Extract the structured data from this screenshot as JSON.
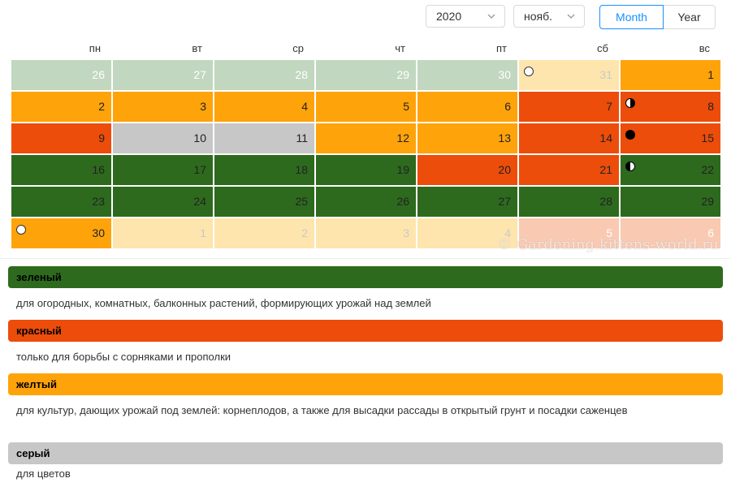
{
  "controls": {
    "year_value": "2020",
    "month_value": "нояб.",
    "mode_month": "Month",
    "mode_year": "Year",
    "accent": "#1890ff"
  },
  "weekdays": [
    "пн",
    "вт",
    "ср",
    "чт",
    "пт",
    "сб",
    "вс"
  ],
  "palette": {
    "prev": "#c1d7bf",
    "green": "#2d6a1e",
    "red": "#ec4d0a",
    "orange": "#ffa30a",
    "gray": "#c7c7c7",
    "paleyellow": "#fde5ad",
    "palepeach": "#f9c9b2"
  },
  "calendar": {
    "rows": [
      [
        [
          "26",
          "prev",
          ""
        ],
        [
          "27",
          "prev",
          ""
        ],
        [
          "28",
          "prev",
          ""
        ],
        [
          "29",
          "prev",
          ""
        ],
        [
          "30",
          "prev",
          ""
        ],
        [
          "31",
          "paleyellow",
          "new"
        ],
        [
          "1",
          "orange",
          ""
        ]
      ],
      [
        [
          "2",
          "orange",
          ""
        ],
        [
          "3",
          "orange",
          ""
        ],
        [
          "4",
          "orange",
          ""
        ],
        [
          "5",
          "orange",
          ""
        ],
        [
          "6",
          "orange",
          ""
        ],
        [
          "7",
          "red",
          ""
        ],
        [
          "8",
          "red",
          "first"
        ]
      ],
      [
        [
          "9",
          "red",
          ""
        ],
        [
          "10",
          "gray",
          ""
        ],
        [
          "11",
          "gray",
          ""
        ],
        [
          "12",
          "orange",
          ""
        ],
        [
          "13",
          "orange",
          ""
        ],
        [
          "14",
          "red",
          ""
        ],
        [
          "15",
          "red",
          "full"
        ]
      ],
      [
        [
          "16",
          "green",
          ""
        ],
        [
          "17",
          "green",
          ""
        ],
        [
          "18",
          "green",
          ""
        ],
        [
          "19",
          "green",
          ""
        ],
        [
          "20",
          "red",
          ""
        ],
        [
          "21",
          "red",
          ""
        ],
        [
          "22",
          "green",
          "last"
        ]
      ],
      [
        [
          "23",
          "green",
          ""
        ],
        [
          "24",
          "green",
          ""
        ],
        [
          "25",
          "green",
          ""
        ],
        [
          "26",
          "green",
          ""
        ],
        [
          "27",
          "green",
          ""
        ],
        [
          "28",
          "green",
          ""
        ],
        [
          "29",
          "green",
          ""
        ]
      ],
      [
        [
          "30",
          "orange",
          "new"
        ],
        [
          "1",
          "paleyellow",
          ""
        ],
        [
          "2",
          "paleyellow",
          ""
        ],
        [
          "3",
          "paleyellow",
          ""
        ],
        [
          "4",
          "paleyellow",
          ""
        ],
        [
          "5",
          "palepeach",
          ""
        ],
        [
          "6",
          "palepeach",
          ""
        ]
      ]
    ]
  },
  "watermark": "© Gardening.kittens-world.ru",
  "legend": [
    {
      "label": "зеленый",
      "color": "#2d6a1e",
      "description": "для огородных, комнатных, балконных растений, формирующих урожай над землей"
    },
    {
      "label": "красный",
      "color": "#ec4d0a",
      "description": "только для борьбы с сорняками и прополки"
    },
    {
      "label": "желтый",
      "color": "#ffa30a",
      "description": "для культур, дающих урожай под землей: корнеплодов, а также для высадки рассады в открытый грунт и посадки саженцев"
    },
    {
      "label": "серый",
      "color": "#c7c7c7",
      "description": "для цветов"
    }
  ]
}
